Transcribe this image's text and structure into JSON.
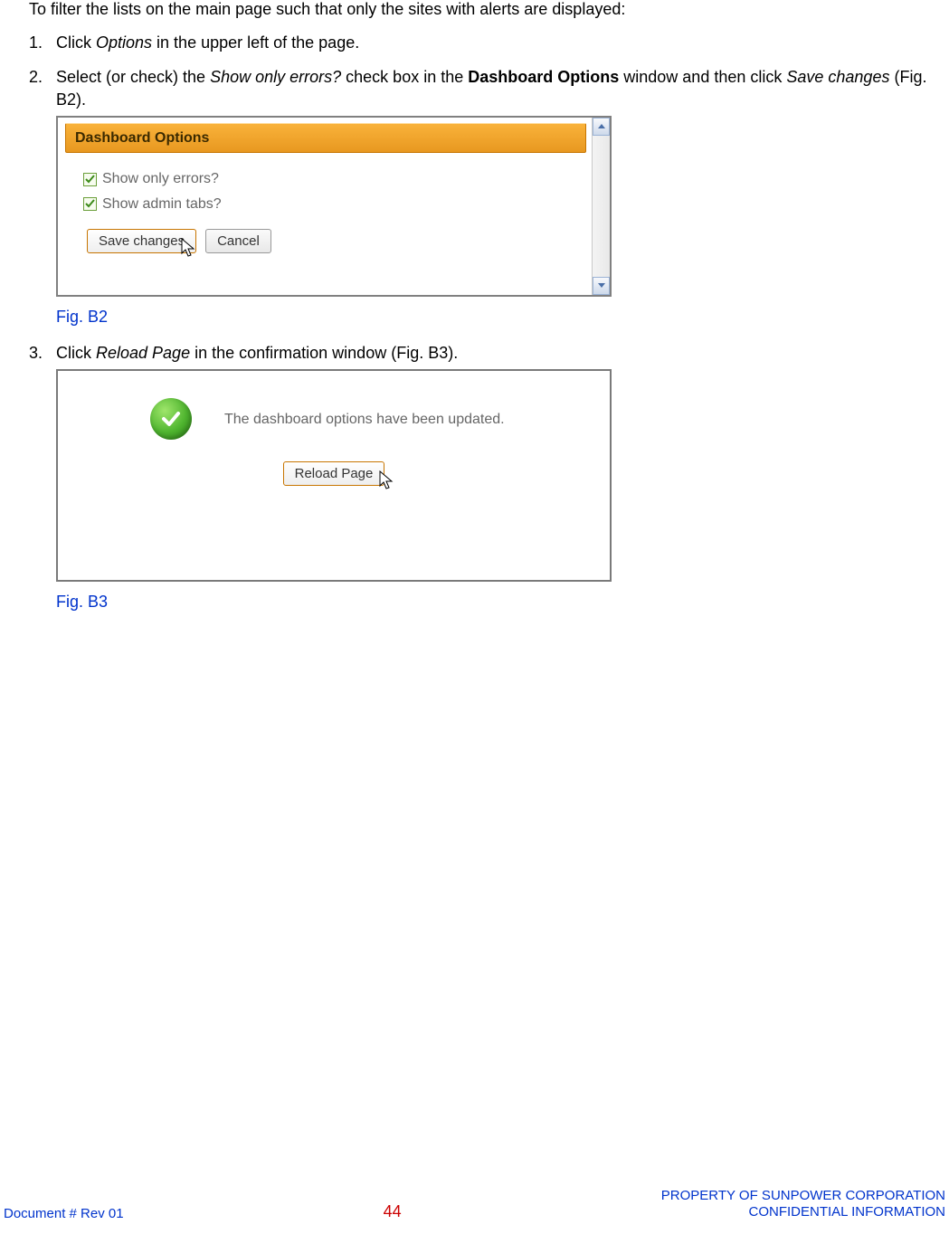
{
  "intro": "To filter the lists on the main page such that only the sites with alerts are displayed:",
  "steps": {
    "s1": {
      "pre": "Click ",
      "em": "Options",
      "post": " in the upper left of the page."
    },
    "s2": {
      "pre": "Select (or check) the ",
      "em1": "Show only errors?",
      "mid": " check box in the ",
      "bold": "Dashboard Options",
      "mid2": " window and then click ",
      "em2": "Save changes",
      "post": " (Fig. B2)."
    },
    "s3": {
      "pre": "Click ",
      "em": "Reload Page",
      "post": " in the confirmation window (Fig. B3)."
    }
  },
  "figB2": {
    "title": "Dashboard Options",
    "chk1": "Show only errors?",
    "chk2": "Show admin tabs?",
    "save": "Save changes",
    "cancel": "Cancel",
    "caption": "Fig. B2"
  },
  "figB3": {
    "message": "The dashboard options have been updated.",
    "reload": "Reload Page",
    "caption": "Fig. B3"
  },
  "footer": {
    "left": "Document #  Rev 01",
    "page": "44",
    "right1": "PROPERTY OF SUNPOWER CORPORATION",
    "right2": "CONFIDENTIAL INFORMATION"
  }
}
